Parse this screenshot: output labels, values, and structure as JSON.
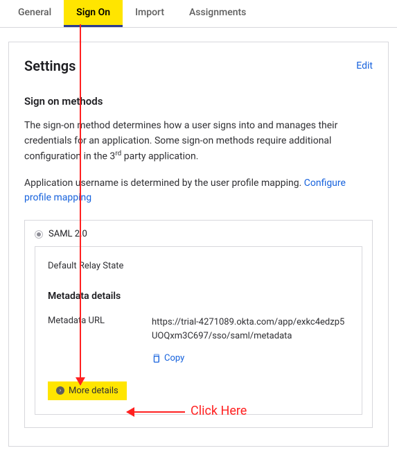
{
  "tabs": {
    "general": "General",
    "signon": "Sign On",
    "import": "Import",
    "assignments": "Assignments"
  },
  "panel": {
    "title": "Settings",
    "edit": "Edit",
    "section_title": "Sign on methods",
    "desc1_a": "The sign-on method determines how a user signs into and manages their credentials for an application. Some sign-on methods require additional configuration in the 3",
    "desc1_sup": "rd",
    "desc1_b": " party application.",
    "desc2": "Application username is determined by the user profile mapping. ",
    "configure_link": "Configure profile mapping"
  },
  "saml": {
    "label": "SAML 2.0",
    "relay_state": "Default Relay State",
    "meta_title": "Metadata details",
    "meta_key": "Metadata URL",
    "meta_val": "https://trial-4271089.okta.com/app/exkc4edzp5UOQxm3C697/sso/saml/metadata",
    "copy": "Copy",
    "more_details": "More details"
  },
  "annotation": {
    "click_here": "Click Here"
  }
}
